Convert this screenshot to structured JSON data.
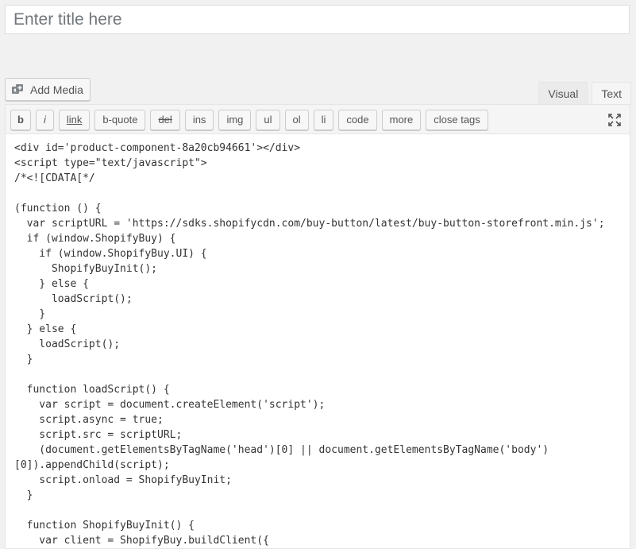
{
  "title": {
    "placeholder": "Enter title here"
  },
  "media": {
    "label": "Add Media",
    "icon": "add-media-icon"
  },
  "tabs": [
    {
      "label": "Visual",
      "active": false
    },
    {
      "label": "Text",
      "active": true
    }
  ],
  "toolbar": {
    "buttons": [
      "b",
      "i",
      "link",
      "b-quote",
      "del",
      "ins",
      "img",
      "ul",
      "ol",
      "li",
      "code",
      "more",
      "close tags"
    ],
    "fullscreen_icon": "fullscreen-icon"
  },
  "code": {
    "lines": [
      "<div id='product-component-8a20cb94661'></div>",
      "<script type=\"text/javascript\">",
      "/*<![CDATA[*/",
      "",
      "(function () {",
      "  var scriptURL = 'https://sdks.shopifycdn.com/buy-button/latest/buy-button-storefront.min.js';",
      "  if (window.ShopifyBuy) {",
      "    if (window.ShopifyBuy.UI) {",
      "      ShopifyBuyInit();",
      "    } else {",
      "      loadScript();",
      "    }",
      "  } else {",
      "    loadScript();",
      "  }",
      "",
      "  function loadScript() {",
      "    var script = document.createElement('script');",
      "    script.async = true;",
      "    script.src = scriptURL;",
      "    (document.getElementsByTagName('head')[0] || document.getElementsByTagName('body')",
      "[0]).appendChild(script);",
      "    script.onload = ShopifyBuyInit;",
      "  }",
      "",
      "  function ShopifyBuyInit() {",
      "    var client = ShopifyBuy.buildClient({"
    ]
  }
}
